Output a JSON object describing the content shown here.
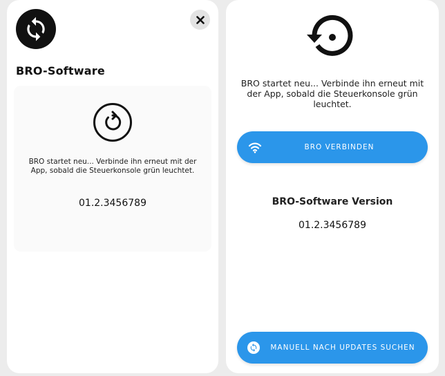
{
  "left_card": {
    "title": "BRO-Software",
    "message": "BRO startet neu... Verbinde ihn erneut mit der App, sobald die Steuerkonsole grün leuchtet.",
    "version": "01.2.3456789",
    "close_icon": "close-icon",
    "logo_icon": "sync-icon",
    "restart_icon": "restart-icon"
  },
  "right_card": {
    "message": "BRO startet neu... Verbinde ihn erneut mit der App, sobald die Steuerkonsole grün leuchtet.",
    "connect_button": "BRO VERBINDEN",
    "connect_icon": "wifi-icon",
    "version_title": "BRO-Software Version",
    "version": "01.2.3456789",
    "update_button": "MANUELL NACH UPDATES SUCHEN",
    "update_icon": "refresh-icon",
    "restore_icon": "restore-icon"
  },
  "colors": {
    "accent": "#2b96ea",
    "background": "#ececec",
    "card": "#ffffff",
    "text": "#111111"
  }
}
